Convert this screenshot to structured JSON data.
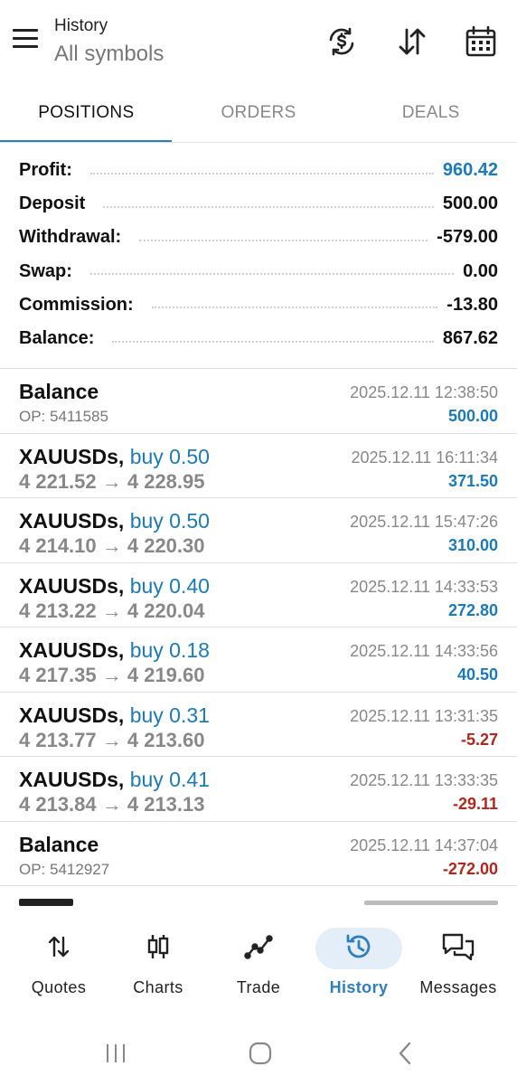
{
  "header": {
    "title": "History",
    "subtitle": "All symbols",
    "icons": [
      "menu-icon",
      "currency-exchange-icon",
      "sort-icon",
      "calendar-icon"
    ]
  },
  "tabs": [
    {
      "label": "POSITIONS",
      "active": true
    },
    {
      "label": "ORDERS",
      "active": false
    },
    {
      "label": "DEALS",
      "active": false
    }
  ],
  "summary": [
    {
      "label": "Profit:",
      "value": "960.42",
      "accent": true
    },
    {
      "label": "Deposit",
      "value": "500.00"
    },
    {
      "label": "Withdrawal:",
      "value": "-579.00"
    },
    {
      "label": "Swap:",
      "value": "0.00"
    },
    {
      "label": "Commission:",
      "value": "-13.80"
    },
    {
      "label": "Balance:",
      "value": "867.62"
    }
  ],
  "items": [
    {
      "kind": "balance",
      "title": "Balance",
      "sub": "OP: 5411585",
      "time": "2025.12.11 12:38:50",
      "value": "500.00",
      "sign": "pos"
    },
    {
      "kind": "trade",
      "symbol": "XAUUSDs,",
      "side": "buy 0.50",
      "prices": "4 221.52 → 4 228.95",
      "time": "2025.12.11 16:11:34",
      "value": "371.50",
      "sign": "pos"
    },
    {
      "kind": "trade",
      "symbol": "XAUUSDs,",
      "side": "buy 0.50",
      "prices": "4 214.10 → 4 220.30",
      "time": "2025.12.11 15:47:26",
      "value": "310.00",
      "sign": "pos"
    },
    {
      "kind": "trade",
      "symbol": "XAUUSDs,",
      "side": "buy 0.40",
      "prices": "4 213.22 → 4 220.04",
      "time": "2025.12.11 14:33:53",
      "value": "272.80",
      "sign": "pos"
    },
    {
      "kind": "trade",
      "symbol": "XAUUSDs,",
      "side": "buy 0.18",
      "prices": "4 217.35 → 4 219.60",
      "time": "2025.12.11 14:33:56",
      "value": "40.50",
      "sign": "pos"
    },
    {
      "kind": "trade",
      "symbol": "XAUUSDs,",
      "side": "buy 0.31",
      "prices": "4 213.77 → 4 213.60",
      "time": "2025.12.11 13:31:35",
      "value": "-5.27",
      "sign": "neg"
    },
    {
      "kind": "trade",
      "symbol": "XAUUSDs,",
      "side": "buy 0.41",
      "prices": "4 213.84 → 4 213.13",
      "time": "2025.12.11 13:33:35",
      "value": "-29.11",
      "sign": "neg"
    },
    {
      "kind": "balance",
      "title": "Balance",
      "sub": "OP: 5412927",
      "time": "2025.12.11 14:37:04",
      "value": "-272.00",
      "sign": "neg"
    }
  ],
  "bottom_nav": [
    {
      "label": "Quotes",
      "icon": "quotes-icon",
      "active": false
    },
    {
      "label": "Charts",
      "icon": "charts-icon",
      "active": false
    },
    {
      "label": "Trade",
      "icon": "trade-icon",
      "active": false
    },
    {
      "label": "History",
      "icon": "history-icon",
      "active": true
    },
    {
      "label": "Messages",
      "icon": "messages-icon",
      "active": false
    }
  ],
  "colors": {
    "accent": "#2f7fbf",
    "positive": "#1b7ab8",
    "negative": "#b3261e"
  }
}
